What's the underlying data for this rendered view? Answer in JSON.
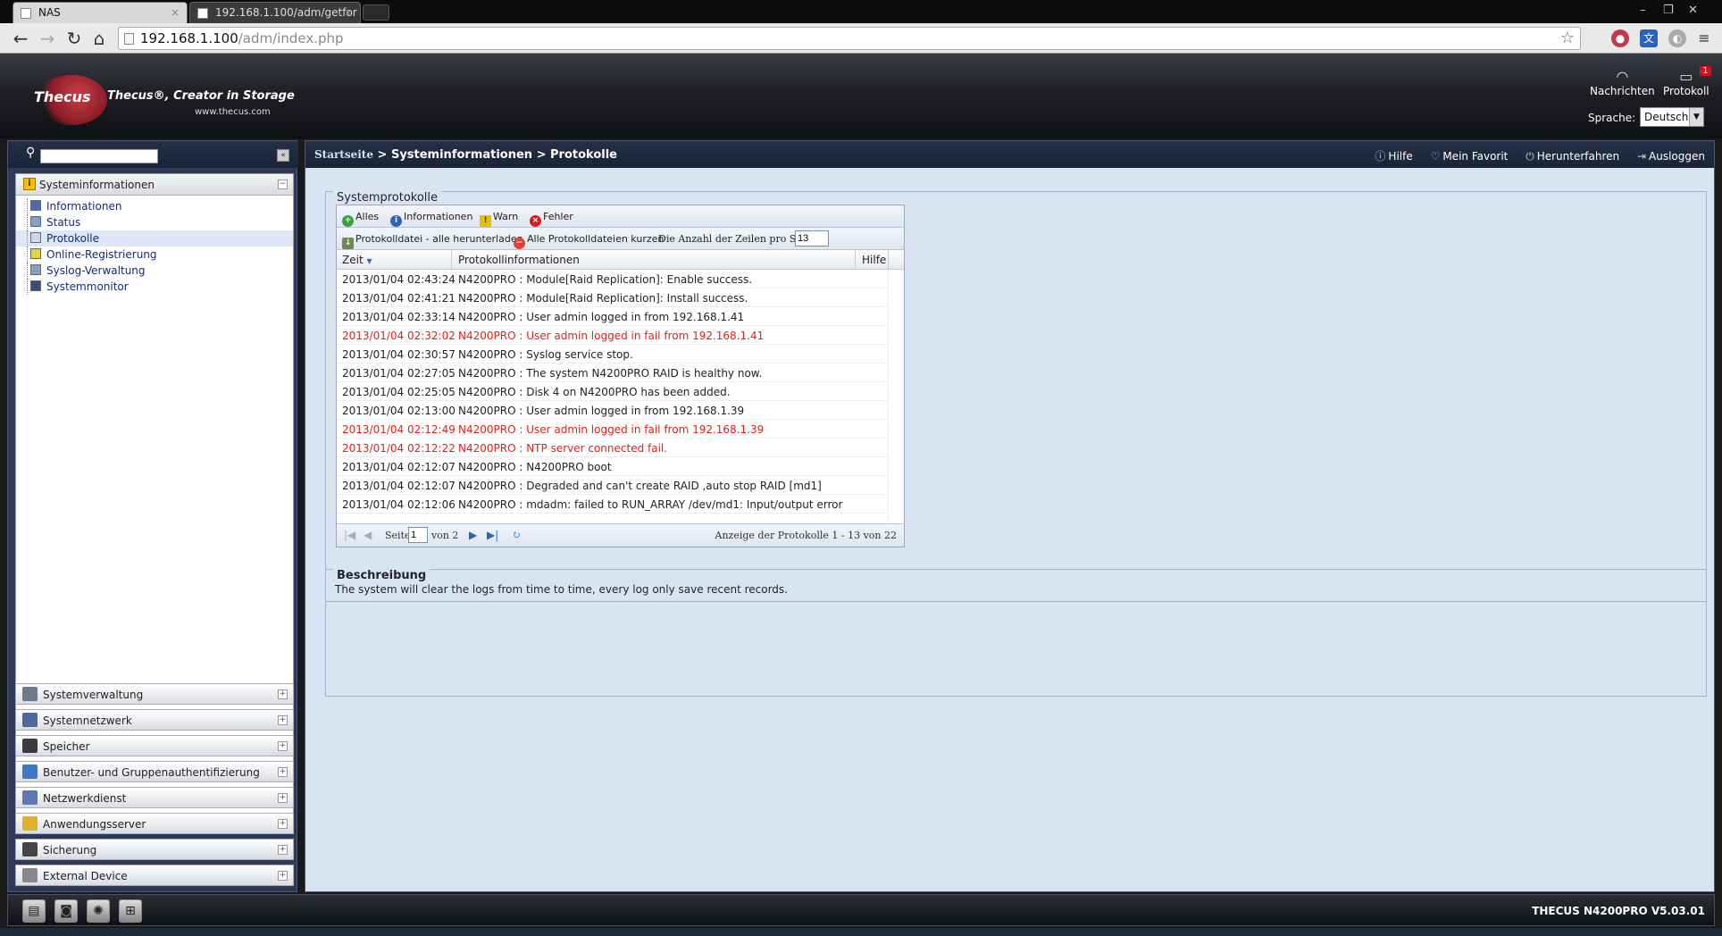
{
  "browser": {
    "tabs": [
      {
        "title": "NAS"
      },
      {
        "title": "192.168.1.100/adm/getfor"
      }
    ],
    "url_host": "192.168.1.100",
    "url_path": "/adm/index.php"
  },
  "header": {
    "logo": "Thecus",
    "tagline": "Thecus®, Creator in Storage",
    "website": "www.thecus.com",
    "news_label": "Nachrichten",
    "log_label": "Protokoll",
    "log_badge": "1",
    "language_label": "Sprache:",
    "language_value": "Deutsch"
  },
  "sidebar": {
    "search_placeholder": "",
    "active_section": "Systeminformationen",
    "items": [
      {
        "label": "Informationen"
      },
      {
        "label": "Status"
      },
      {
        "label": "Protokolle"
      },
      {
        "label": "Online-Registrierung"
      },
      {
        "label": "Syslog-Verwaltung"
      },
      {
        "label": "Systemmonitor"
      }
    ],
    "sections": [
      {
        "label": "Systemverwaltung"
      },
      {
        "label": "Systemnetzwerk"
      },
      {
        "label": "Speicher"
      },
      {
        "label": "Benutzer- und Gruppenauthentifizierung"
      },
      {
        "label": "Netzwerkdienst"
      },
      {
        "label": "Anwendungsserver"
      },
      {
        "label": "Sicherung"
      },
      {
        "label": "External Device"
      }
    ]
  },
  "breadcrumb": {
    "home": "Startseite",
    "sep": ">",
    "level1": "Systeminformationen",
    "level2": "Protokolle"
  },
  "toplinks": {
    "help": "Hilfe",
    "favorite": "Mein Favorit",
    "shutdown": "Herunterfahren",
    "logout": "Ausloggen"
  },
  "syslog": {
    "title": "Systemprotokolle",
    "filters": {
      "all": "Alles",
      "info": "Informationen",
      "warn": "Warn",
      "error": "Fehler"
    },
    "download_all": "Protokolldatei - alle herunterladen",
    "truncate_all": "Alle Protokolldateien kurzen",
    "rows_label": "Die Anzahl der Zeilen pro Seite",
    "rows_value": "13",
    "columns": {
      "time": "Zeit",
      "info": "Protokollinformationen",
      "help": "Hilfe"
    },
    "rows": [
      {
        "time": "2013/01/04 02:43:24",
        "msg": "N4200PRO : Module[Raid Replication]: Enable success.",
        "error": false
      },
      {
        "time": "2013/01/04 02:41:21",
        "msg": "N4200PRO : Module[Raid Replication]: Install success.",
        "error": false
      },
      {
        "time": "2013/01/04 02:33:14",
        "msg": "N4200PRO : User admin logged in from 192.168.1.41",
        "error": false
      },
      {
        "time": "2013/01/04 02:32:02",
        "msg": "N4200PRO : User admin logged in fail from 192.168.1.41",
        "error": true
      },
      {
        "time": "2013/01/04 02:30:57",
        "msg": "N4200PRO : Syslog service stop.",
        "error": false
      },
      {
        "time": "2013/01/04 02:27:05",
        "msg": "N4200PRO : The system N4200PRO RAID is healthy now.",
        "error": false
      },
      {
        "time": "2013/01/04 02:25:05",
        "msg": "N4200PRO : Disk 4 on N4200PRO has been added.",
        "error": false
      },
      {
        "time": "2013/01/04 02:13:00",
        "msg": "N4200PRO : User admin logged in from 192.168.1.39",
        "error": false
      },
      {
        "time": "2013/01/04 02:12:49",
        "msg": "N4200PRO : User admin logged in fail from 192.168.1.39",
        "error": true
      },
      {
        "time": "2013/01/04 02:12:22",
        "msg": "N4200PRO : NTP server connected fail.",
        "error": true
      },
      {
        "time": "2013/01/04 02:12:07",
        "msg": "N4200PRO : N4200PRO boot",
        "error": false
      },
      {
        "time": "2013/01/04 02:12:07",
        "msg": "N4200PRO : Degraded and can't create RAID ,auto stop RAID [md1]",
        "error": false
      },
      {
        "time": "2013/01/04 02:12:06",
        "msg": "N4200PRO : mdadm: failed to RUN_ARRAY /dev/md1: Input/output error",
        "error": false
      }
    ],
    "pager": {
      "page_label": "Seite",
      "page_value": "1",
      "of_label": "von 2",
      "display_info": "Anzeige der Protokolle 1 - 13 von 22"
    }
  },
  "description": {
    "title": "Beschreibung",
    "text": "The system will clear the logs from time to time, every log only save recent records."
  },
  "footer": {
    "version": "THECUS N4200PRO V5.03.01"
  },
  "colors": {
    "error_text": "#e0201c",
    "link_blue": "#1a2a6a",
    "content_bg": "#d9e4f3"
  }
}
